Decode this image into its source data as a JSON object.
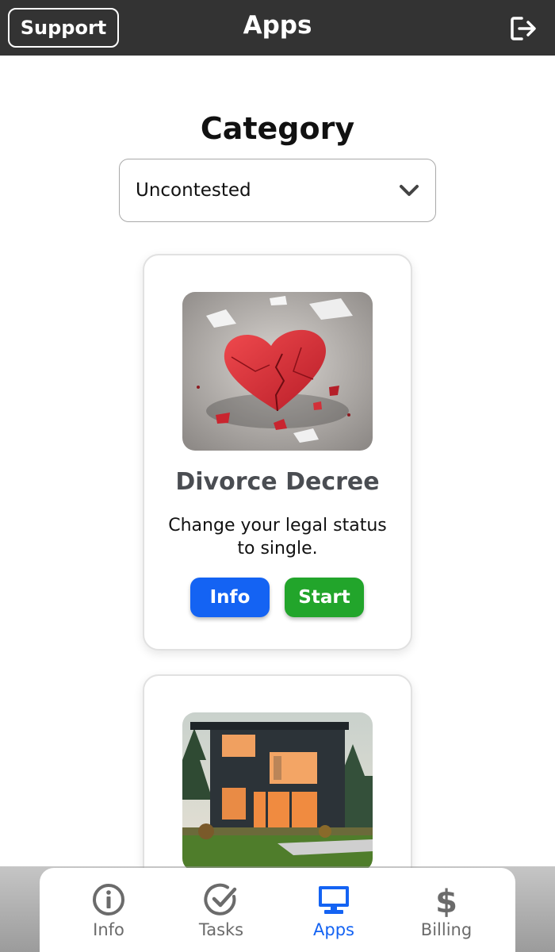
{
  "header": {
    "support_label": "Support",
    "title": "Apps",
    "logout_icon": "logout-icon"
  },
  "category": {
    "heading": "Category",
    "selected": "Uncontested"
  },
  "cards": [
    {
      "title": "Divorce Decree",
      "description": "Change your legal status to single.",
      "info_label": "Info",
      "start_label": "Start",
      "image": "broken-heart-image"
    },
    {
      "image": "modern-house-image"
    }
  ],
  "tabs": [
    {
      "label": "Info",
      "icon": "info-circle-icon",
      "active": false
    },
    {
      "label": "Tasks",
      "icon": "check-circle-icon",
      "active": false
    },
    {
      "label": "Apps",
      "icon": "monitor-icon",
      "active": true
    },
    {
      "label": "Billing",
      "icon": "dollar-icon",
      "active": false
    }
  ],
  "colors": {
    "header_bg": "#333333",
    "info_button": "#1463f3",
    "start_button": "#22a52b",
    "active_tab": "#1463f3",
    "inactive_tab": "#6b6b6b"
  }
}
